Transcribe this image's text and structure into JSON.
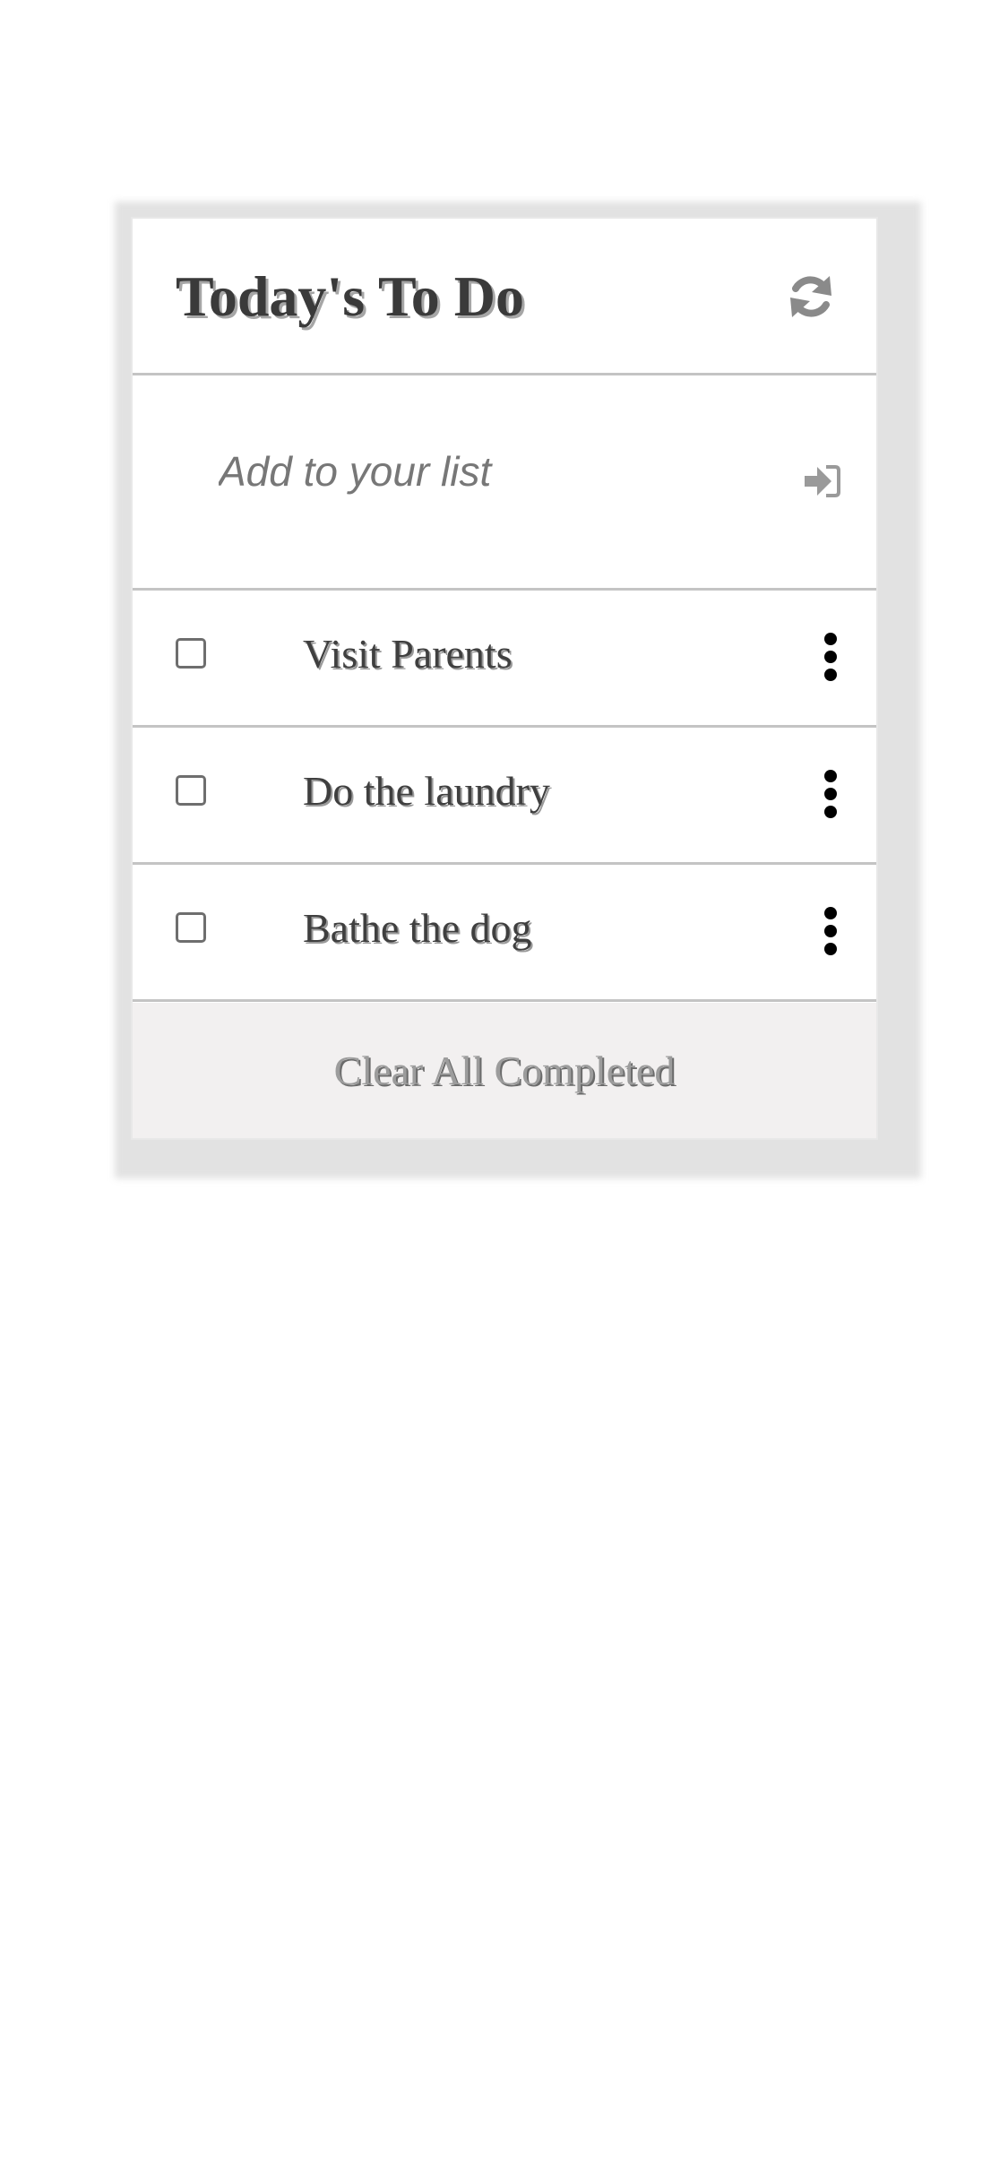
{
  "header": {
    "title": "Today's To Do",
    "refresh_icon": "refresh-icon"
  },
  "add": {
    "placeholder": "Add to your list",
    "value": "",
    "submit_icon": "sign-in-icon"
  },
  "todos": [
    {
      "label": "Visit Parents",
      "checked": false
    },
    {
      "label": "Do the laundry",
      "checked": false
    },
    {
      "label": "Bathe the dog",
      "checked": false
    }
  ],
  "footer": {
    "clear_label": "Clear All Completed"
  },
  "colors": {
    "card_border": "#c4c4c4",
    "title": "#3a3a3a",
    "footer_bg": "#f2f0f0",
    "icon_gray": "#8a8a8a"
  }
}
